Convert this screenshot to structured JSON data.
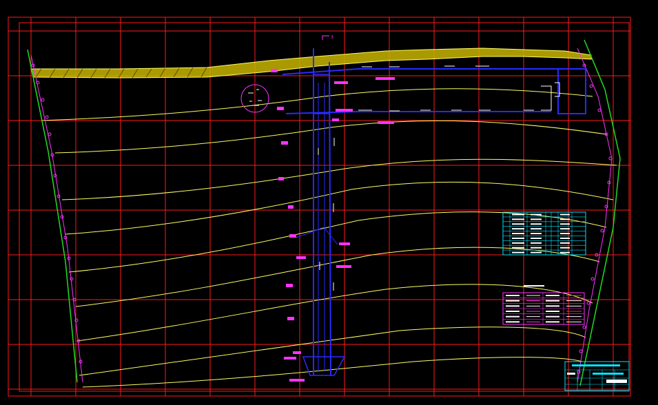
{
  "drawing": {
    "background": "#000000",
    "colors": {
      "grid": "#ff1a1a",
      "frame": "#ff1a1a",
      "contour": "#ffff66",
      "boundary_green": "#22dd22",
      "boundary_magenta": "#ff33ff",
      "shaft": "#2a2aff",
      "label_tag": "#ff33ff",
      "table": "#00e5ff",
      "legend_border": "#ff33ff",
      "hatch": "#c8b400"
    },
    "section_marker": "3",
    "title_block": {
      "title": "",
      "rows": []
    }
  }
}
